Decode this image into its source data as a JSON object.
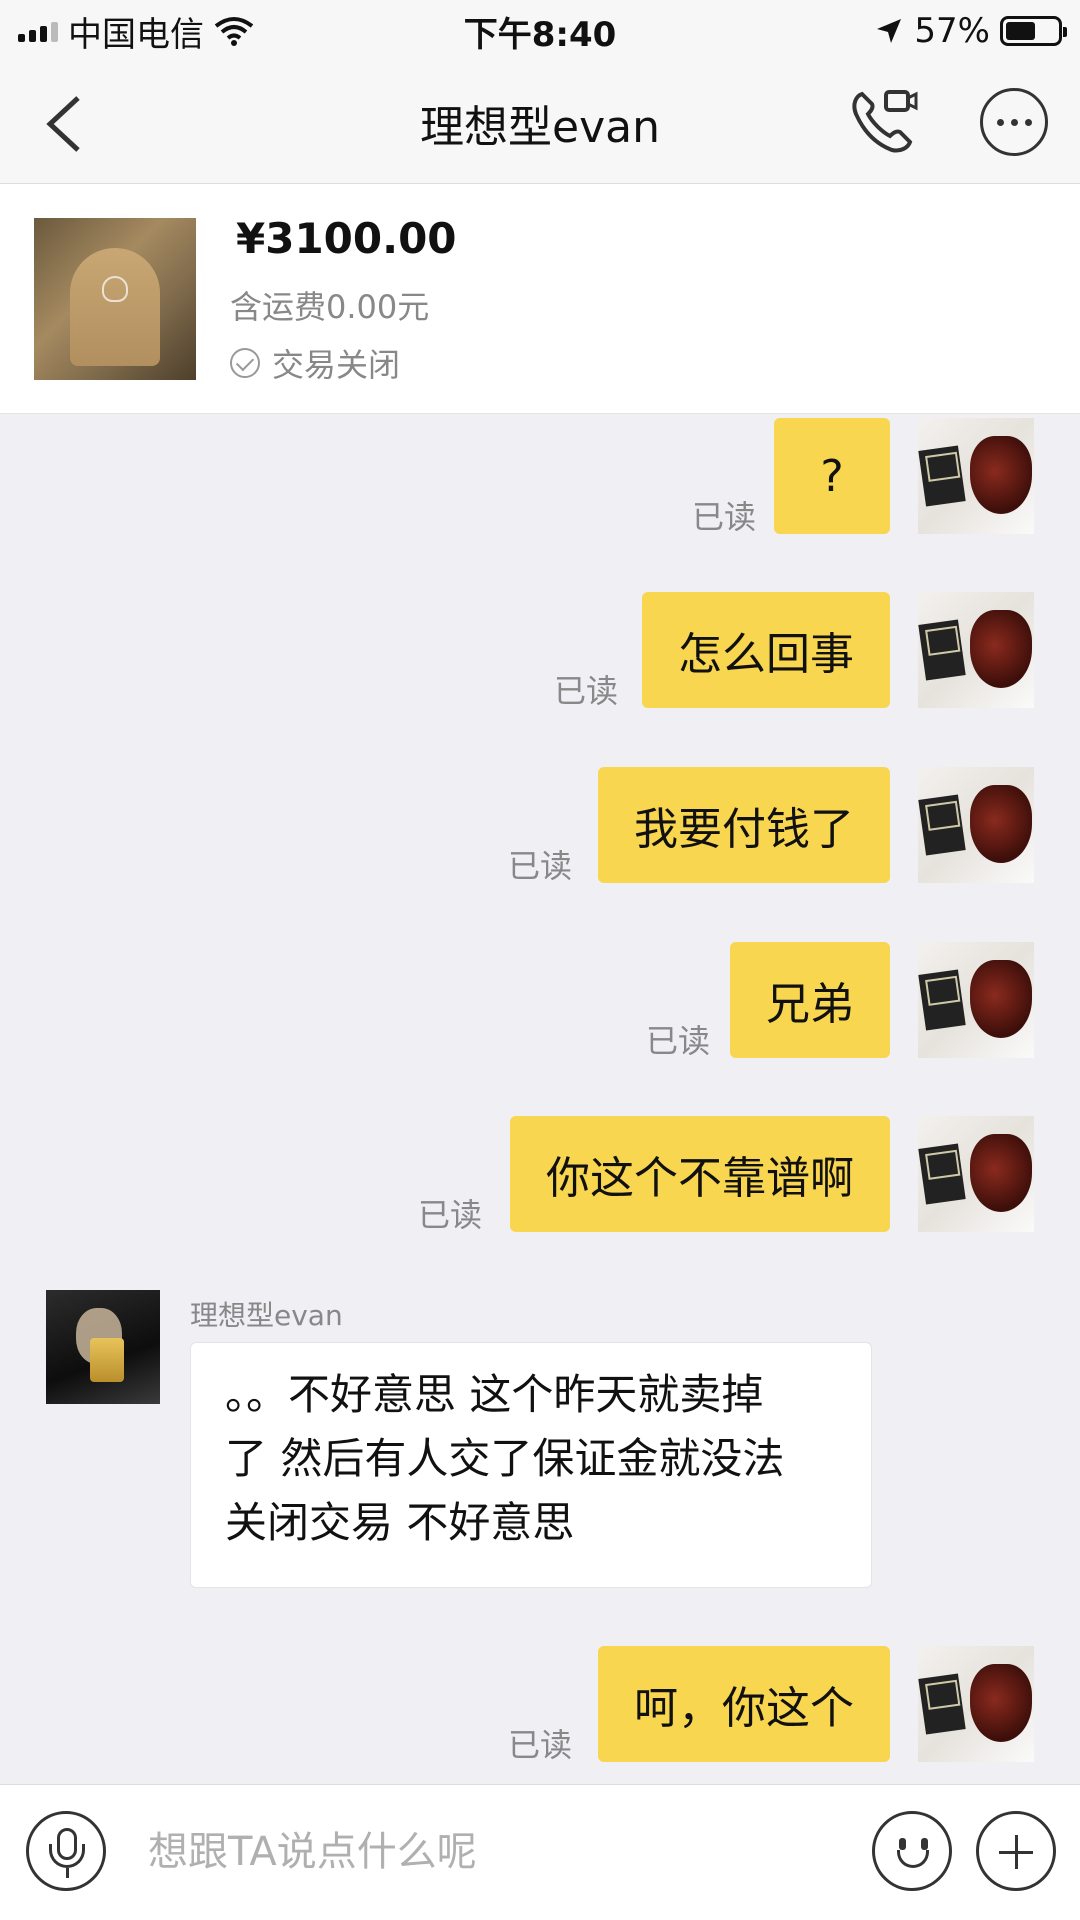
{
  "status_bar": {
    "carrier": "中国电信",
    "time": "下午8:40",
    "battery_percent": "57%",
    "battery_level": 0.57,
    "icons": [
      "signal-icon",
      "wifi-icon",
      "location-arrow-icon",
      "battery-icon"
    ]
  },
  "nav": {
    "title": "理想型evan",
    "icons": [
      "back-icon",
      "phone-video-call-icon",
      "more-icon"
    ]
  },
  "product": {
    "price": "¥3100.00",
    "shipping": "含运费0.00元",
    "status": "交易关闭",
    "status_icon": "check-circle-icon"
  },
  "messages": [
    {
      "from": "me",
      "text": "?",
      "read": "已读"
    },
    {
      "from": "me",
      "text": "怎么回事",
      "read": "已读"
    },
    {
      "from": "me",
      "text": "我要付钱了",
      "read": "已读"
    },
    {
      "from": "me",
      "text": "兄弟",
      "read": "已读"
    },
    {
      "from": "me",
      "text": "你这个不靠谱啊",
      "read": "已读"
    },
    {
      "from": "other",
      "sender": "理想型evan",
      "lines": [
        "。。不好意思 这个昨天就卖掉",
        "了 然后有人交了保证金就没法",
        "关闭交易 不好意思"
      ]
    },
    {
      "from": "me",
      "text": "呵，你这个",
      "read": "已读"
    }
  ],
  "input": {
    "placeholder": "想跟TA说点什么呢",
    "value": ""
  },
  "colors": {
    "outgoing_bubble": "#f9d64f",
    "incoming_bubble": "#ffffff",
    "background": "#efeff4"
  }
}
